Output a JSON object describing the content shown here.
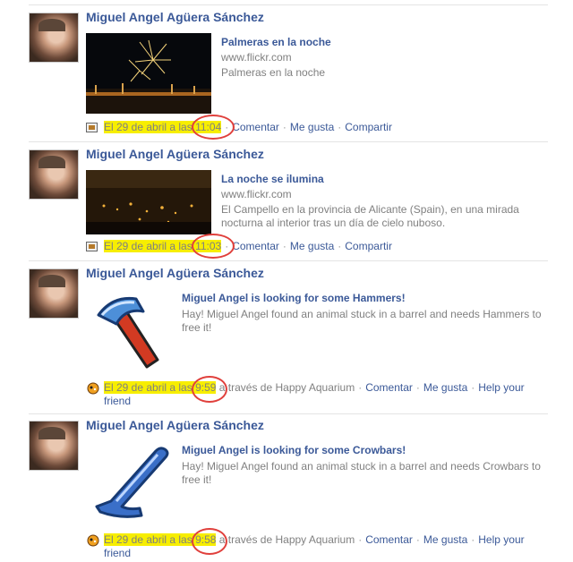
{
  "stories": [
    {
      "author": "Miguel Angel Agüera Sánchez",
      "link_title": "Palmeras en la noche",
      "link_domain": "www.flickr.com",
      "link_desc": "Palmeras en la noche",
      "date_prefix": "El 29 de abril a las",
      "time": "11:04",
      "actions": [
        "Comentar",
        "Me gusta",
        "Compartir"
      ]
    },
    {
      "author": "Miguel Angel Agüera Sánchez",
      "link_title": "La noche se ilumina",
      "link_domain": "www.flickr.com",
      "link_desc": "El Campello en la provincia de Alicante (Spain), en una mirada nocturna al interior tras un día de cielo nuboso.",
      "date_prefix": "El 29 de abril a las",
      "time": "11:03",
      "actions": [
        "Comentar",
        "Me gusta",
        "Compartir"
      ]
    },
    {
      "author": "Miguel Angel Agüera Sánchez",
      "link_title": "Miguel Angel is looking for some Hammers!",
      "link_desc": "Hay! Miguel Angel found an animal stuck in a barrel and needs Hammers to free it!",
      "date_prefix": "El 29 de abril a las",
      "time": "9:59",
      "via": "a través de Happy Aquarium",
      "actions": [
        "Comentar",
        "Me gusta",
        "Help your friend"
      ]
    },
    {
      "author": "Miguel Angel Agüera Sánchez",
      "link_title": "Miguel Angel is looking for some Crowbars!",
      "link_desc": "Hay! Miguel Angel found an animal stuck in a barrel and needs Crowbars to free it!",
      "date_prefix": "El 29 de abril a las",
      "time": "9:58",
      "via": "a través de Happy Aquarium",
      "actions": [
        "Comentar",
        "Me gusta",
        "Help your friend"
      ]
    }
  ],
  "colors": {
    "link": "#3b5998",
    "highlight": "#f7ee00",
    "annotation_circle": "#e0403c"
  },
  "icons": [
    "photo-post-icon",
    "happy-aquarium-icon",
    "hammer-icon",
    "crowbar-icon"
  ]
}
